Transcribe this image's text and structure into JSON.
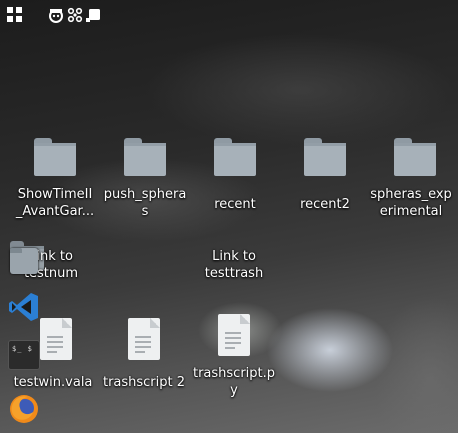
{
  "topbar": {
    "apps_icon": "apps-grid-icon",
    "indicators": [
      "face-icon",
      "network-icon",
      "square-icon"
    ]
  },
  "desktop": {
    "items": [
      {
        "label_lines": [
          "ShowTimeII",
          "_AvantGar..."
        ],
        "icon": "folder-icon"
      },
      {
        "label_lines": [
          "push_sphera",
          "s"
        ],
        "icon": "folder-icon"
      },
      {
        "label_lines": [
          "recent"
        ],
        "icon": "folder-icon"
      },
      {
        "label_lines": [
          "recent2"
        ],
        "icon": "folder-icon"
      },
      {
        "label_lines": [
          "spheras_exp",
          "erimental"
        ],
        "icon": "folder-icon"
      },
      {
        "label_lines": [
          "Link to",
          "testnum"
        ],
        "icon": "folder-link-icon"
      },
      {
        "label_lines": [
          "Link to",
          "testtrash"
        ],
        "icon": "link-icon"
      },
      {
        "label_lines": [
          "testwin.vala"
        ],
        "icon": "document-icon"
      },
      {
        "label_lines": [
          "trashscript 2"
        ],
        "icon": "document-icon"
      },
      {
        "label_lines": [
          "trashscript.p",
          "y"
        ],
        "icon": "document-icon"
      }
    ]
  },
  "dock": {
    "items": [
      "file-manager-icon",
      "vscode-icon",
      "terminal-icon",
      "firefox-icon"
    ],
    "terminal_text": "$_ $"
  },
  "colors": {
    "folder": "#a7b1b9",
    "vscode": "#2b7fd4",
    "firefox": "#f08a1a"
  }
}
